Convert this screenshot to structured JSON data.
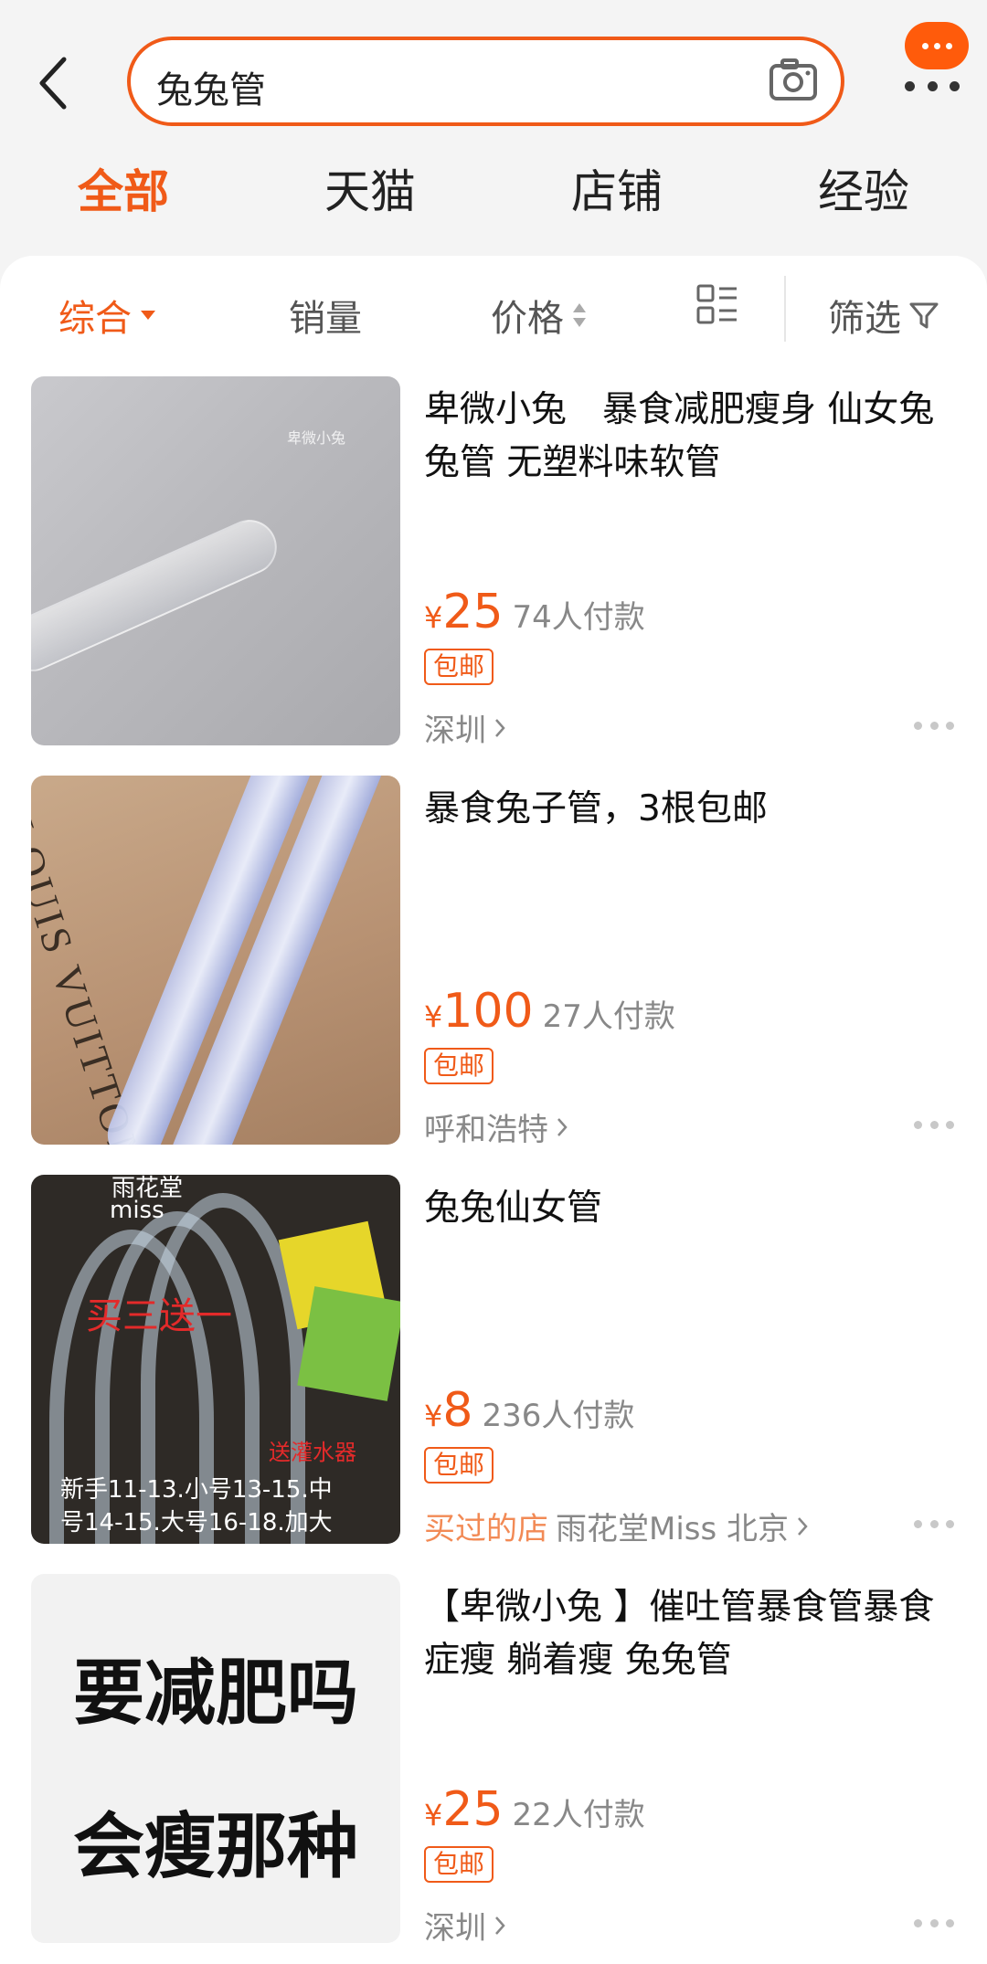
{
  "header": {
    "search_query": "兔兔管",
    "top_tabs": [
      "全部",
      "天猫",
      "店铺",
      "经验"
    ]
  },
  "sort_bar": {
    "items": [
      "综合",
      "销量",
      "价格"
    ],
    "filter_label": "筛选"
  },
  "products": [
    {
      "title": "卑微小兔　暴食减肥瘦身 仙女兔兔管  无塑料味软管",
      "yen": "¥",
      "price": "25",
      "sales": "74人付款",
      "badge": "包邮",
      "location": "深圳",
      "thumb_watermark": "卑微小兔"
    },
    {
      "title": "暴食兔子管，3根包邮",
      "yen": "¥",
      "price": "100",
      "sales": "27人付款",
      "badge": "包邮",
      "location": "呼和浩特",
      "thumb_text": "LOUIS VUITTON"
    },
    {
      "title": "兔兔仙女管",
      "yen": "¥",
      "price": "8",
      "sales": "236人付款",
      "badge": "包邮",
      "bought_label": "买过的店",
      "shop_location": "雨花堂Miss 北京",
      "thumb_texts": {
        "brand1": "雨花堂",
        "brand2": "miss",
        "promo": "买三送一",
        "gift": "送灌水器",
        "sizes1": "新手11-13.小号13-15.中",
        "sizes2": "号14-15.大号16-18.加大"
      }
    },
    {
      "title": "【卑微小兔 】催吐管暴食管暴食症瘦 躺着瘦 兔兔管",
      "yen": "¥",
      "price": "25",
      "sales": "22人付款",
      "badge": "包邮",
      "location": "深圳",
      "thumb_line1": "要减肥吗",
      "thumb_line2": "会瘦那种"
    }
  ],
  "colors": {
    "accent": "#f05a18",
    "muted": "#888888"
  }
}
